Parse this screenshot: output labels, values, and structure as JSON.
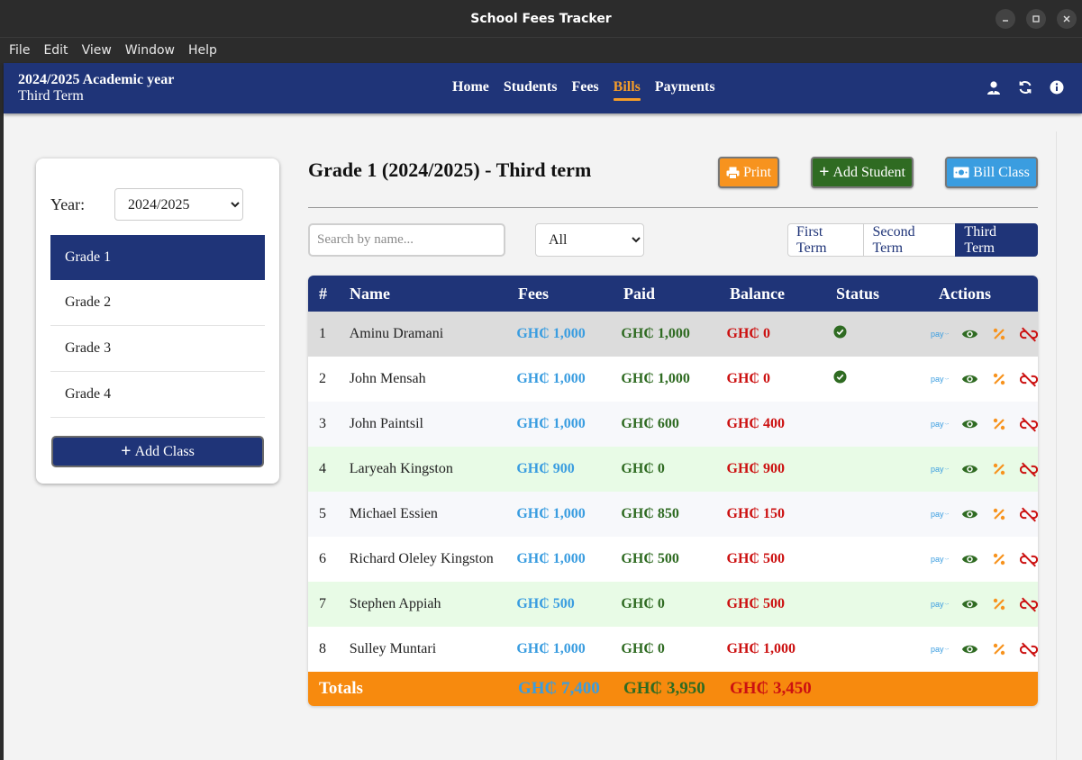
{
  "window": {
    "title": "School Fees Tracker"
  },
  "menu": [
    "File",
    "Edit",
    "View",
    "Window",
    "Help"
  ],
  "navbar": {
    "year": "2024/2025 Academic year",
    "term": "Third Term",
    "links": [
      "Home",
      "Students",
      "Fees",
      "Bills",
      "Payments"
    ],
    "active_link": "Bills",
    "accent_color": "#f39c2a"
  },
  "sidebar": {
    "year_label": "Year:",
    "year_value": "2024/2025",
    "grades": [
      "Grade 1",
      "Grade 2",
      "Grade 3",
      "Grade 4"
    ],
    "active_grade": "Grade 1",
    "add_class_label": "Add Class"
  },
  "main": {
    "title": "Grade 1 (2024/2025) - Third term",
    "print_label": "Print",
    "add_student_label": "Add Student",
    "bill_class_label": "Bill Class",
    "search_placeholder": "Search by name...",
    "filter_value": "All",
    "terms": [
      "First Term",
      "Second Term",
      "Third Term"
    ],
    "active_term": "Third Term"
  },
  "table": {
    "headers": [
      "#",
      "Name",
      "Fees",
      "Paid",
      "Balance",
      "Status",
      "Actions"
    ],
    "rows": [
      {
        "num": "1",
        "name": "Aminu Dramani",
        "fees": "GH₵ 1,000",
        "paid": "GH₵ 1,000",
        "balance": "GH₵ 0",
        "paid_full": true
      },
      {
        "num": "2",
        "name": "John Mensah",
        "fees": "GH₵ 1,000",
        "paid": "GH₵ 1,000",
        "balance": "GH₵ 0",
        "paid_full": true
      },
      {
        "num": "3",
        "name": "John Paintsil",
        "fees": "GH₵ 1,000",
        "paid": "GH₵ 600",
        "balance": "GH₵ 400",
        "paid_full": false
      },
      {
        "num": "4",
        "name": "Laryeah Kingston",
        "fees": "GH₵ 900",
        "paid": "GH₵ 0",
        "balance": "GH₵ 900",
        "paid_full": false
      },
      {
        "num": "5",
        "name": "Michael Essien",
        "fees": "GH₵ 1,000",
        "paid": "GH₵ 850",
        "balance": "GH₵ 150",
        "paid_full": false
      },
      {
        "num": "6",
        "name": "Richard Oleley Kingston",
        "fees": "GH₵ 1,000",
        "paid": "GH₵ 500",
        "balance": "GH₵ 500",
        "paid_full": false
      },
      {
        "num": "7",
        "name": "Stephen Appiah",
        "fees": "GH₵ 500",
        "paid": "GH₵ 0",
        "balance": "GH₵ 500",
        "paid_full": false
      },
      {
        "num": "8",
        "name": "Sulley Muntari",
        "fees": "GH₵ 1,000",
        "paid": "GH₵ 0",
        "balance": "GH₵ 1,000",
        "paid_full": false
      }
    ],
    "totals": {
      "label": "Totals",
      "fees": "GH₵ 7,400",
      "paid": "GH₵ 3,950",
      "balance": "GH₵ 3,450"
    },
    "action_icons": [
      "pay-icon",
      "eye-icon",
      "percent-icon",
      "unlink-icon"
    ],
    "pay_icon_text": "pay",
    "colors": {
      "fees": "#3a9de0",
      "paid": "#2f6b22",
      "balance": "#cc1111",
      "totals_bg": "#f78a0e",
      "header_bg": "#1f3478"
    }
  }
}
